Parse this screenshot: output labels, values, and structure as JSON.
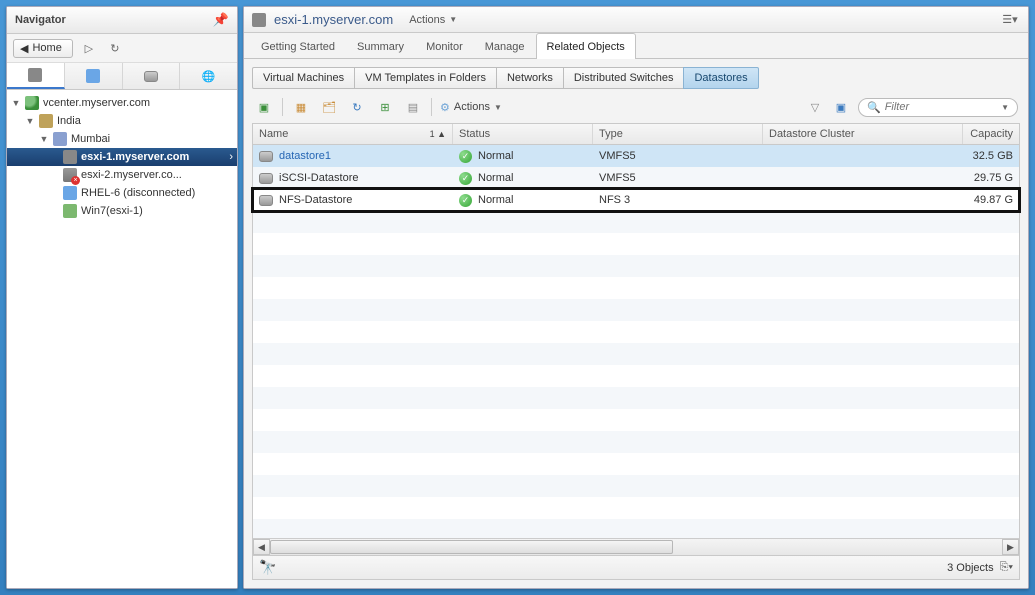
{
  "navigator": {
    "title": "Navigator",
    "home_label": "Home",
    "tree": {
      "root": "vcenter.myserver.com",
      "dc": "India",
      "cluster": "Mumbai",
      "host1": "esxi-1.myserver.com",
      "host2": "esxi-2.myserver.co...",
      "vm1": "RHEL-6 (disconnected)",
      "vm2": "Win7(esxi-1)"
    }
  },
  "content": {
    "title": "esxi-1.myserver.com",
    "actions_label": "Actions",
    "main_tabs": [
      "Getting Started",
      "Summary",
      "Monitor",
      "Manage",
      "Related Objects"
    ],
    "sub_tabs": [
      "Virtual Machines",
      "VM Templates in Folders",
      "Networks",
      "Distributed Switches",
      "Datastores"
    ],
    "toolbar_actions_label": "Actions",
    "filter_placeholder": "Filter",
    "columns": {
      "name": "Name",
      "status": "Status",
      "type": "Type",
      "cluster": "Datastore Cluster",
      "capacity": "Capacity",
      "sort_indicator": "1 ▲"
    },
    "rows": [
      {
        "name": "datastore1",
        "status": "Normal",
        "type": "VMFS5",
        "cluster": "",
        "capacity": "32.5 GB",
        "selected": true
      },
      {
        "name": "iSCSI-Datastore",
        "status": "Normal",
        "type": "VMFS5",
        "cluster": "",
        "capacity": "29.75 G"
      },
      {
        "name": "NFS-Datastore",
        "status": "Normal",
        "type": "NFS 3",
        "cluster": "",
        "capacity": "49.87 G",
        "highlight": true
      }
    ],
    "footer_count": "3 Objects"
  }
}
